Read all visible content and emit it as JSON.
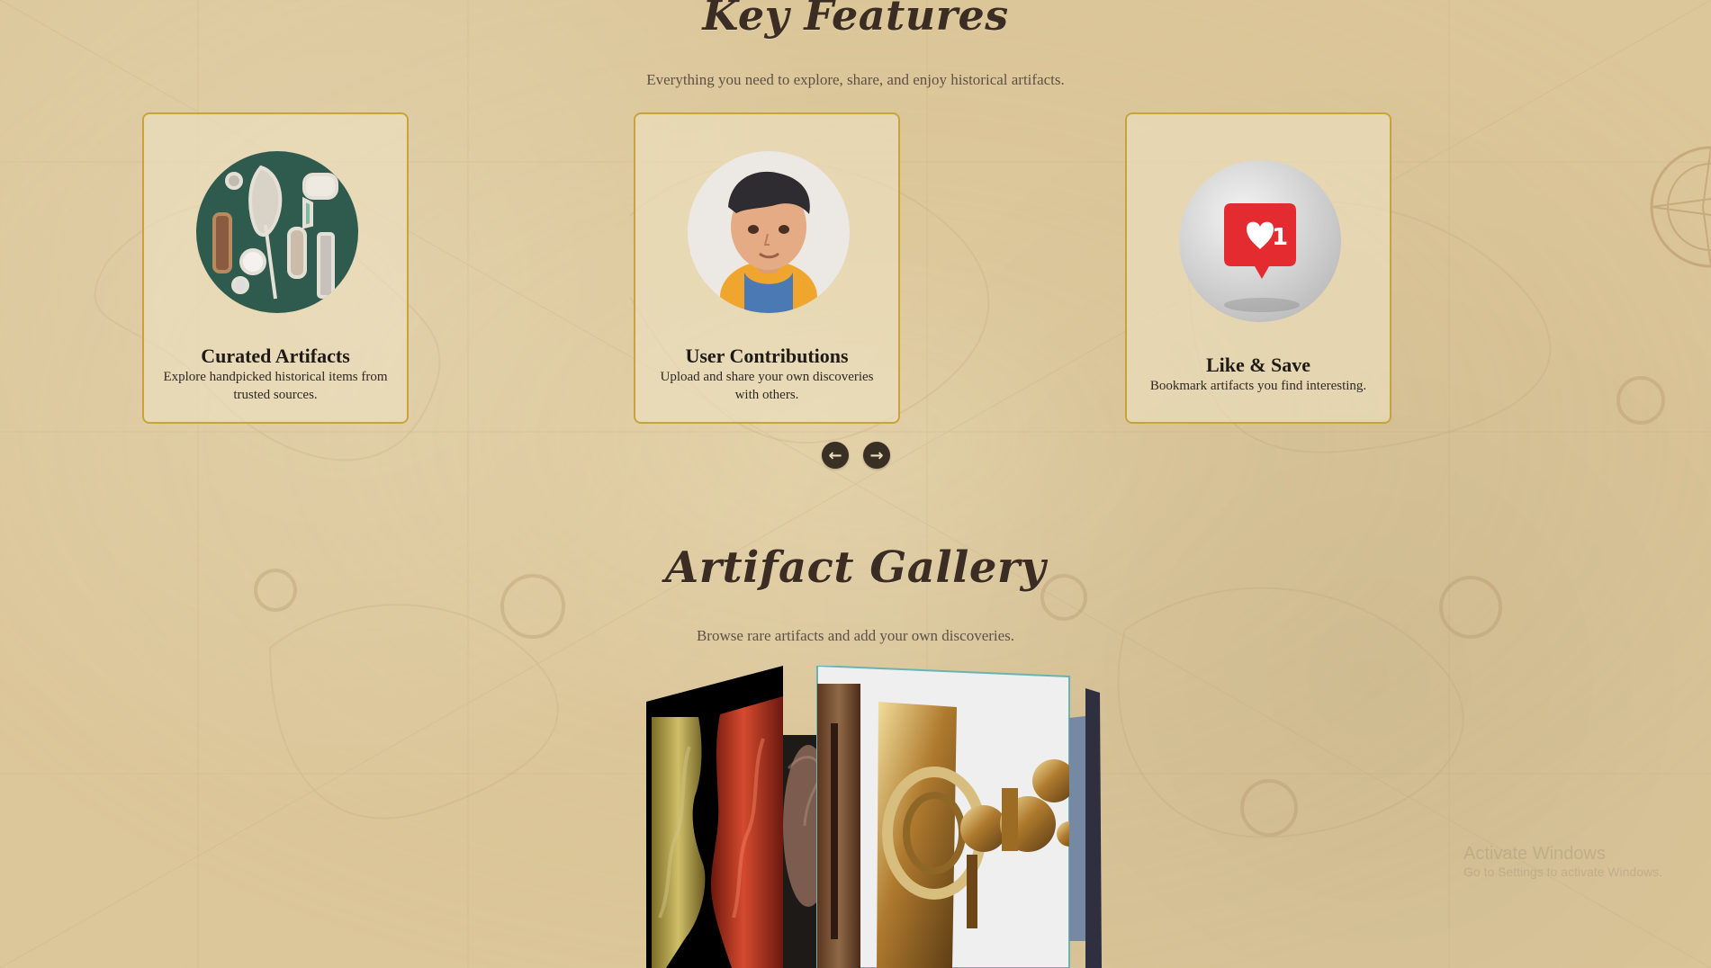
{
  "sections": {
    "key_features": {
      "title": "Key Features",
      "subtitle": "Everything you need to explore, share, and enjoy historical artifacts.",
      "cards": [
        {
          "title": "Curated Artifacts",
          "description": "Explore handpicked historical items from trusted sources."
        },
        {
          "title": "User Contributions",
          "description": "Upload and share your own discoveries with others."
        },
        {
          "title": "Like & Save",
          "description": "Bookmark artifacts you find interesting."
        }
      ],
      "carousel_controls": {
        "previous_icon": "←",
        "next_icon": "→"
      }
    },
    "artifact_gallery": {
      "title": "Artifact Gallery",
      "subtitle": "Browse rare artifacts and add your own discoveries."
    }
  },
  "overlay": {
    "watermark_title": "Activate Windows",
    "watermark_subtitle": "Go to Settings to activate Windows."
  },
  "theme": {
    "background": "#dcc79a",
    "card_border": "#c7a43b",
    "text": "#3a2f25",
    "nav_button": "#3a2f24"
  }
}
